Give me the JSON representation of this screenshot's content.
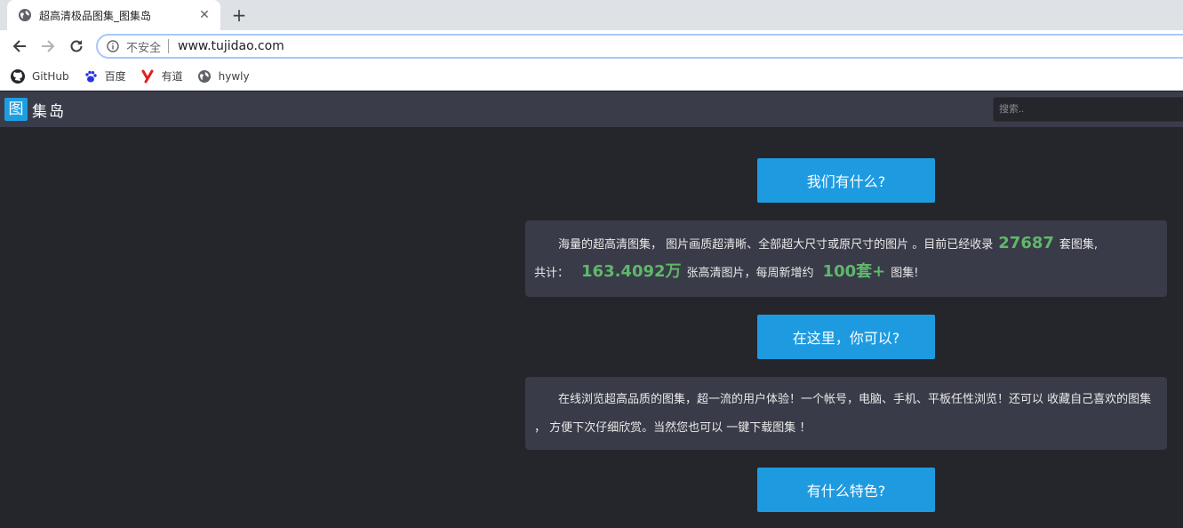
{
  "browser": {
    "tab_title": "超高清极品图集_图集岛",
    "new_tab_label": "+",
    "close_label": "✕",
    "insecure_label": "不安全",
    "url": "www.tujidao.com",
    "bookmarks": [
      {
        "label": "GitHub",
        "icon": "github-icon"
      },
      {
        "label": "百度",
        "icon": "baidu-paw-icon"
      },
      {
        "label": "有道",
        "icon": "youdao-icon"
      },
      {
        "label": "hywly",
        "icon": "globe-icon"
      }
    ]
  },
  "site": {
    "logo_char": "图",
    "logo_text": "集岛",
    "search_placeholder": "搜索.."
  },
  "sections": {
    "btn1": "我们有什么?",
    "card1_a": "海量的超高清图集， 图片画质超清晰、全部超大尺寸或原尺寸的图片 。目前已经收录",
    "card1_count": "27687",
    "card1_b": "套图集,",
    "card1_c": "共计：",
    "card1_total": "163.4092万",
    "card1_d": "张高清图片，每周新增约",
    "card1_weekly": "100套+",
    "card1_e": "图集!",
    "btn2": "在这里，你可以?",
    "card2": "在线浏览超高品质的图集，超一流的用户体验！一个帐号，电脑、手机、平板任性浏览！还可以 收藏自己喜欢的图集 ， 方便下次仔细欣赏。当然您也可以 一键下载图集 ！",
    "btn3": "有什么特色?"
  },
  "colors": {
    "accent": "#1e9be0",
    "highlight": "#5fb86b",
    "page_bg": "#25262c",
    "card_bg": "#393b48",
    "header_bg": "#3a3c4a"
  }
}
